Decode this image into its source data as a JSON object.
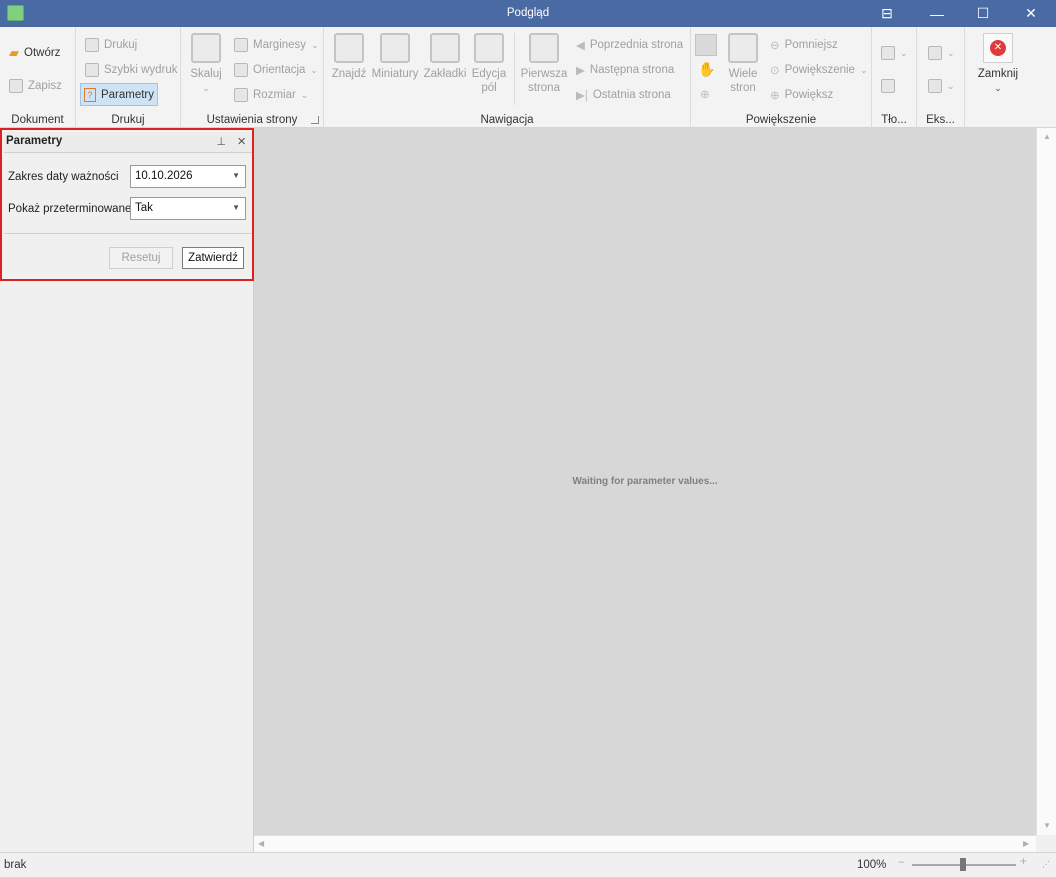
{
  "window": {
    "title": "Podgląd"
  },
  "ribbon": {
    "dokument": {
      "label": "Dokument",
      "open": "Otwórz",
      "save": "Zapisz"
    },
    "drukuj": {
      "label": "Drukuj",
      "print": "Drukuj",
      "quick": "Szybki wydruk",
      "params": "Parametry"
    },
    "ustawienia": {
      "label": "Ustawienia strony",
      "scale": "Skaluj",
      "margins": "Marginesy",
      "orientation": "Orientacja",
      "size": "Rozmiar"
    },
    "nawigacja": {
      "label": "Nawigacja",
      "find": "Znajdź",
      "thumbs": "Miniatury",
      "bookmarks": "Zakładki",
      "edit1": "Edycja",
      "edit2": "pól",
      "first1": "Pierwsza",
      "first2": "strona",
      "prev": "Poprzednia strona",
      "next": "Następna strona",
      "last": "Ostatnia strona"
    },
    "powiekszenie": {
      "label": "Powiększenie",
      "many1": "Wiele",
      "many2": "stron",
      "zoomout": "Pomniejsz",
      "zoom": "Powiększenie",
      "zoomin": "Powiększ"
    },
    "tlo": {
      "label": "Tło..."
    },
    "eks": {
      "label": "Eks..."
    },
    "close": {
      "label": "Zamknij"
    }
  },
  "params_panel": {
    "title": "Parametry",
    "fields": [
      {
        "label": "Zakres daty ważności",
        "value": "10.10.2026"
      },
      {
        "label": "Pokaż przeterminowane",
        "value": "Tak"
      }
    ],
    "reset": "Resetuj",
    "submit": "Zatwierdź"
  },
  "viewer": {
    "message": "Waiting for parameter values..."
  },
  "status": {
    "left": "brak",
    "zoom": "100%",
    "zoom_level": 1.0
  }
}
